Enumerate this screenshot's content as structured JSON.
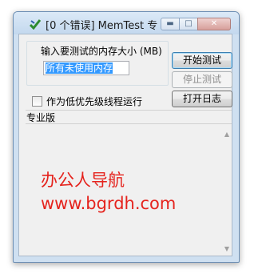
{
  "window": {
    "title": "[0 个错误] MemTest 专..."
  },
  "memory_group": {
    "label": "输入要测试的内存大小 (MB)",
    "input_value": "所有未使用内存"
  },
  "buttons": {
    "start": "开始测试",
    "stop": "停止测试",
    "open_log": "打开日志"
  },
  "options": {
    "low_priority_label": "作为低优先级线程运行",
    "low_priority_checked": false
  },
  "edition": "专业版",
  "watermark": {
    "line1": "办公人导航",
    "line2": "www.bgrdh.com",
    "color": "#e5231d"
  }
}
